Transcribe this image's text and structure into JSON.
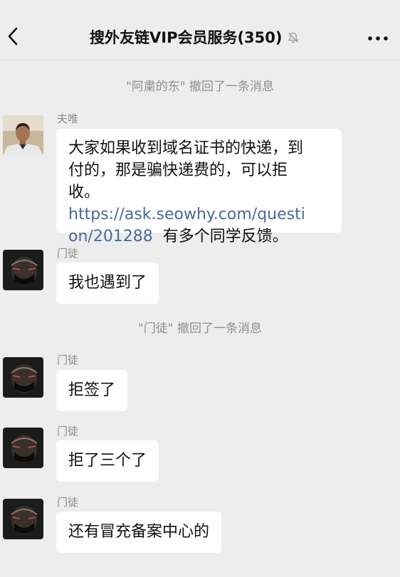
{
  "header": {
    "title": "搜外友链VIP会员服务(350)",
    "back_icon": "chevron-left-icon",
    "mute_icon": "bell-off-icon",
    "more_icon": "more-dots-icon"
  },
  "system_messages": [
    "\"阿粛的东\" 撤回了一条消息",
    "\"门徒\" 撤回了一条消息"
  ],
  "messages": [
    {
      "sender": "夫唯",
      "lines_pre": [
        "大家如果收到域名证书的快递，到",
        "付的，那是骗快递费的，可以拒"
      ],
      "text_before_link": "收。",
      "link_part1": "https://ask.seowhy.com/questi",
      "link_part2": "on/201288",
      "text_after_link": "  有多个同学反馈。"
    },
    {
      "sender": "门徒",
      "text": "我也遇到了"
    },
    {
      "sender": "门徒",
      "text": "拒签了"
    },
    {
      "sender": "门徒",
      "text": "拒了三个了"
    },
    {
      "sender": "门徒",
      "text": "还有冒充备案中心的"
    }
  ],
  "colors": {
    "background": "#ededed",
    "bubble": "#ffffff",
    "link": "#4a6a98",
    "system_text": "#8f8f8f"
  }
}
